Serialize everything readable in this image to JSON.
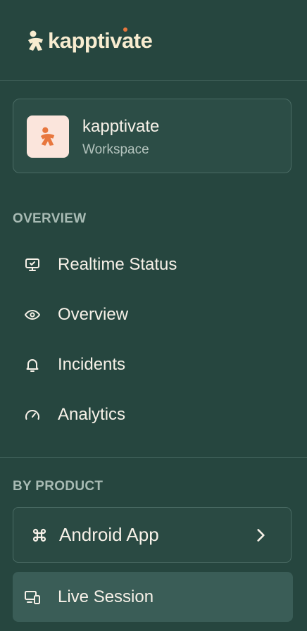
{
  "brand": {
    "name": "kapptivate",
    "logo_icon": "kapptivate-logo-icon",
    "accent": "#e8773e"
  },
  "workspace": {
    "name": "kapptivate",
    "subtitle": "Workspace"
  },
  "overview": {
    "label": "OVERVIEW",
    "items": [
      {
        "label": "Realtime Status",
        "icon": "monitor-icon"
      },
      {
        "label": "Overview",
        "icon": "eye-icon"
      },
      {
        "label": "Incidents",
        "icon": "bell-icon"
      },
      {
        "label": "Analytics",
        "icon": "gauge-icon"
      }
    ]
  },
  "by_product": {
    "label": "BY PRODUCT",
    "product": {
      "label": "Android App",
      "icon": "command-icon"
    },
    "active_item": {
      "label": "Live Session",
      "icon": "devices-icon"
    }
  },
  "colors": {
    "background": "#26463f",
    "text": "#f7f1e8",
    "muted": "#a8bbb4"
  }
}
